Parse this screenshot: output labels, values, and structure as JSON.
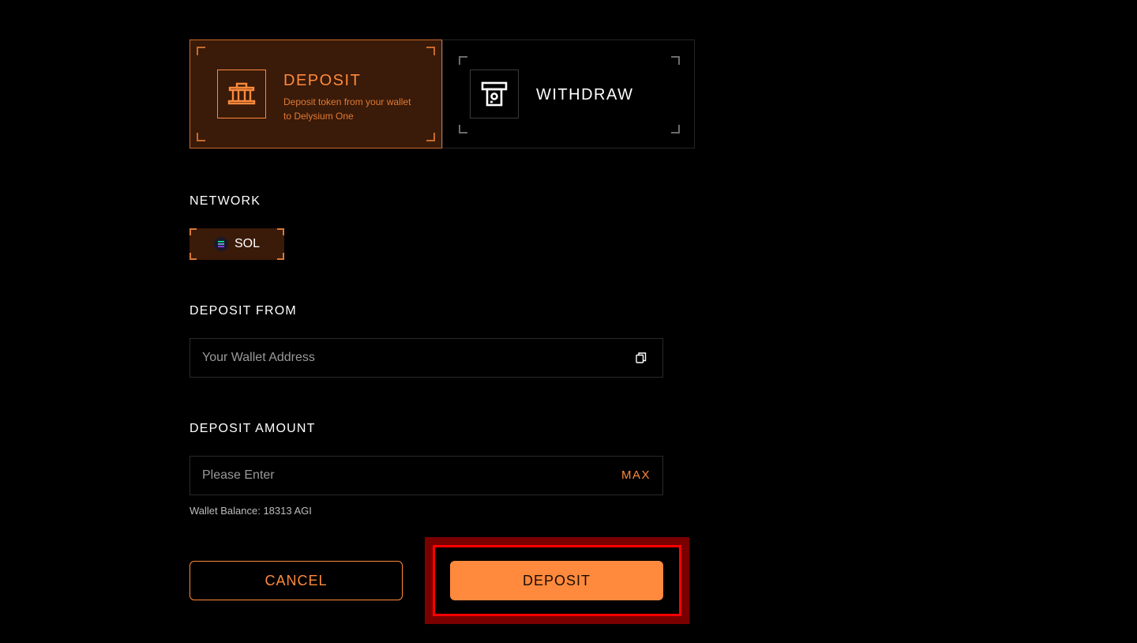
{
  "tabs": {
    "deposit": {
      "title": "DEPOSIT",
      "description": "Deposit token from your wallet to Delysium One",
      "icon": "bank-icon",
      "active": true
    },
    "withdraw": {
      "title": "WITHDRAW",
      "icon": "atm-withdraw-icon",
      "active": false
    }
  },
  "network": {
    "label": "NETWORK",
    "selected": "SOL",
    "icon": "solana-logo-icon"
  },
  "deposit_from": {
    "label": "DEPOSIT FROM",
    "placeholder": "Your Wallet Address",
    "value": "",
    "action_icon": "copy-icon"
  },
  "deposit_amount": {
    "label": "DEPOSIT AMOUNT",
    "placeholder": "Please Enter",
    "value": "",
    "max_label": "MAX",
    "balance_text": "Wallet Balance: 18313 AGI"
  },
  "actions": {
    "cancel_label": "CANCEL",
    "deposit_label": "DEPOSIT"
  },
  "colors": {
    "accent": "#ff8a3d",
    "active_tab_bg": "#3a1a08",
    "highlight": "#ff0000"
  }
}
